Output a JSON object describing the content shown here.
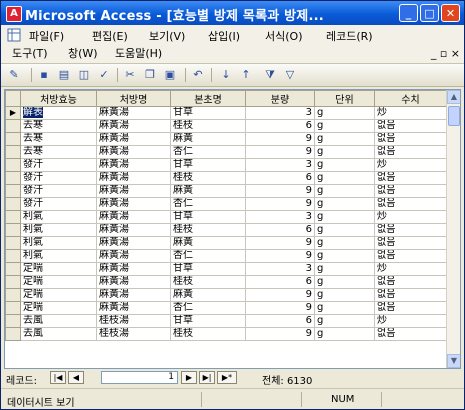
{
  "window": {
    "title": "Microsoft Access - [효능별 방제 목록과 방제...",
    "min_label": "_",
    "max_label": "□",
    "close_label": "✕"
  },
  "menu": {
    "row1": [
      "파일(F)",
      "편집(E)",
      "보기(V)",
      "삽입(I)",
      "서식(O)",
      "레코드(R)"
    ],
    "row2": [
      "도구(T)",
      "창(W)",
      "도움말(H)"
    ],
    "doc_controls": "_ ▫ ×"
  },
  "toolbar": {
    "icons": [
      "view-icon",
      "save-icon",
      "print-icon",
      "print-preview-icon",
      "spelling-icon",
      "cut-icon",
      "copy-icon",
      "paste-icon",
      "undo-icon",
      "sort-ascending-icon",
      "sort-descending-icon",
      "filter-icon",
      "apply-filter-icon"
    ]
  },
  "grid": {
    "columns": [
      "처방효능",
      "처방명",
      "본초명",
      "분량",
      "단위",
      "수치"
    ],
    "rows": [
      [
        "解表",
        "麻黃湯",
        "甘草",
        "3",
        "g",
        "炒"
      ],
      [
        "去寒",
        "麻黃湯",
        "桂枝",
        "6",
        "g",
        "없음"
      ],
      [
        "去寒",
        "麻黃湯",
        "麻黃",
        "9",
        "g",
        "없음"
      ],
      [
        "去寒",
        "麻黃湯",
        "杏仁",
        "9",
        "g",
        "없음"
      ],
      [
        "發汗",
        "麻黃湯",
        "甘草",
        "3",
        "g",
        "炒"
      ],
      [
        "發汗",
        "麻黃湯",
        "桂枝",
        "6",
        "g",
        "없음"
      ],
      [
        "發汗",
        "麻黃湯",
        "麻黃",
        "9",
        "g",
        "없음"
      ],
      [
        "發汗",
        "麻黃湯",
        "杏仁",
        "9",
        "g",
        "없음"
      ],
      [
        "利氣",
        "麻黃湯",
        "甘草",
        "3",
        "g",
        "炒"
      ],
      [
        "利氣",
        "麻黃湯",
        "桂枝",
        "6",
        "g",
        "없음"
      ],
      [
        "利氣",
        "麻黃湯",
        "麻黃",
        "9",
        "g",
        "없음"
      ],
      [
        "利氣",
        "麻黃湯",
        "杏仁",
        "9",
        "g",
        "없음"
      ],
      [
        "定喘",
        "麻黃湯",
        "甘草",
        "3",
        "g",
        "炒"
      ],
      [
        "定喘",
        "麻黃湯",
        "桂枝",
        "6",
        "g",
        "없음"
      ],
      [
        "定喘",
        "麻黃湯",
        "麻黃",
        "9",
        "g",
        "없음"
      ],
      [
        "定喘",
        "麻黃湯",
        "杏仁",
        "9",
        "g",
        "없음"
      ],
      [
        "去風",
        "桂枝湯",
        "甘草",
        "6",
        "g",
        "炒"
      ],
      [
        "去風",
        "桂枝湯",
        "桂枝",
        "9",
        "g",
        "없음"
      ]
    ],
    "current_row": 0
  },
  "navigation": {
    "label": "레코드:",
    "first": "|◀",
    "prev": "◀",
    "next": "▶",
    "last": "▶|",
    "new": "▶*",
    "current": "1",
    "total": "전체: 6130"
  },
  "status": {
    "mode": "데이터시트 보기",
    "num": "NUM"
  }
}
